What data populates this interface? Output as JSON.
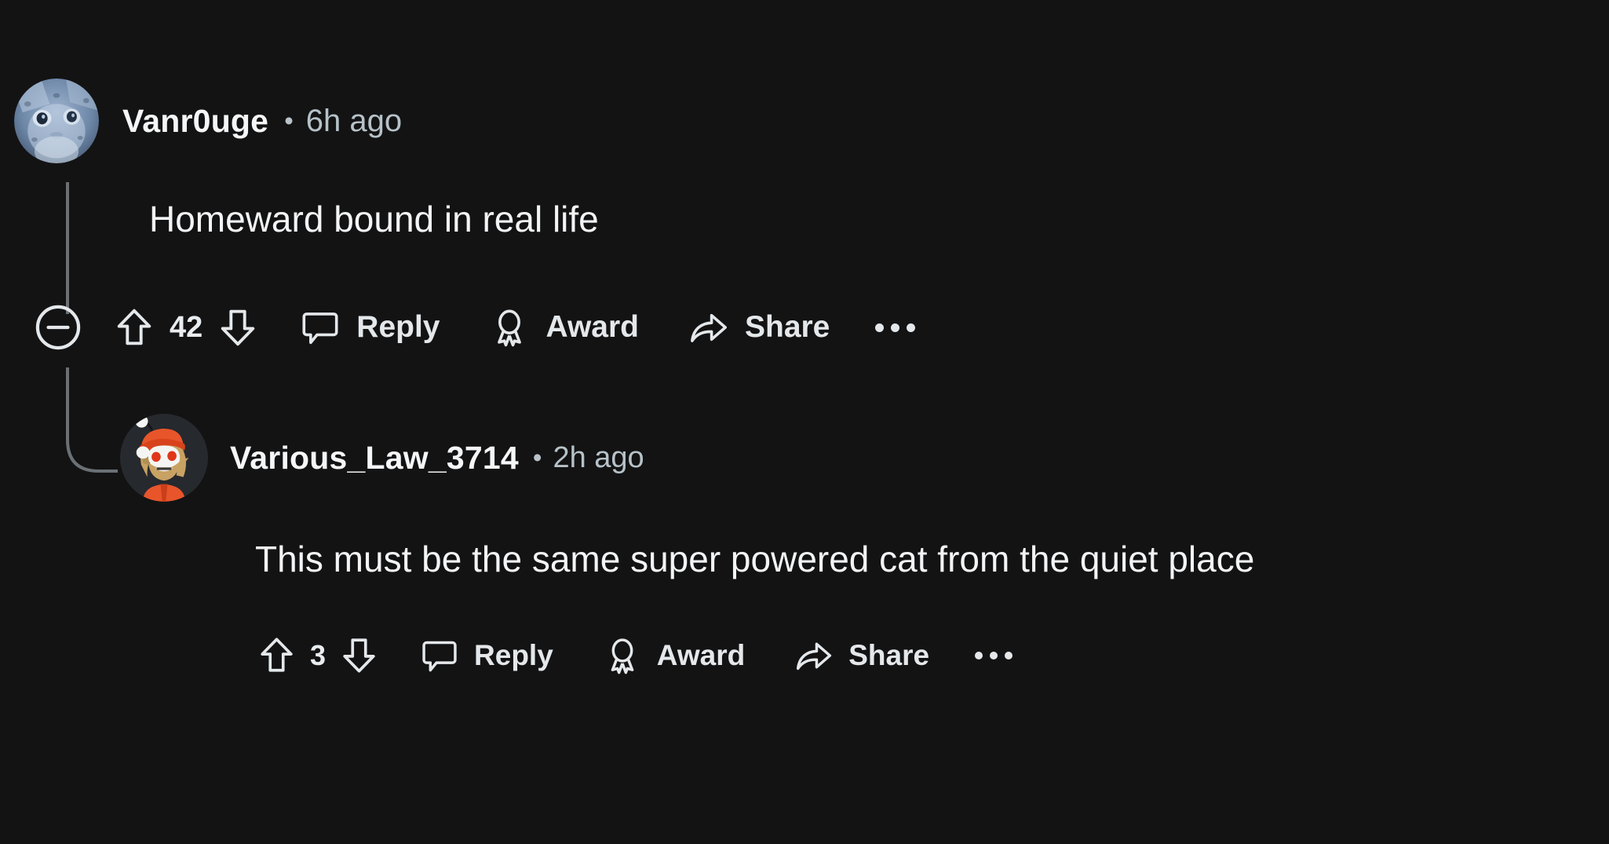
{
  "theme": {
    "background": "#131314",
    "text_primary": "#f3f4f5",
    "text_muted": "#b6c2c8",
    "icon_stroke": "#e4e8eb",
    "thread_line": "#6b7074"
  },
  "comments": [
    {
      "id": "top-comment",
      "author": "Vanr0uge",
      "separator": "•",
      "timestamp": "6h ago",
      "body": "Homeward bound in real life",
      "score": "42",
      "avatar": {
        "name": "snow-leopard-avatar",
        "kind": "photo",
        "description": "snow leopard face",
        "colors": [
          "#8fa6c4",
          "#5d7699",
          "#c8d6e6",
          "#2b3a4f"
        ]
      },
      "actions": {
        "collapse": "collapse-thread",
        "upvote": "upvote",
        "downvote": "downvote",
        "reply_label": "Reply",
        "award_label": "Award",
        "share_label": "Share",
        "more_label": "More options"
      }
    },
    {
      "id": "nested-reply",
      "author": "Various_Law_3714",
      "separator": "•",
      "timestamp": "2h ago",
      "body": "This must be the same super powered cat from the quiet place",
      "score": "3",
      "avatar": {
        "name": "snoo-avatar",
        "kind": "snoo",
        "description": "Reddit Snoo with orange beanie and beard",
        "colors": [
          "#e8552b",
          "#d9a55f",
          "#f2f2f0",
          "#1c1f22"
        ]
      },
      "actions": {
        "upvote": "upvote",
        "downvote": "downvote",
        "reply_label": "Reply",
        "award_label": "Award",
        "share_label": "Share",
        "more_label": "More options"
      }
    }
  ]
}
